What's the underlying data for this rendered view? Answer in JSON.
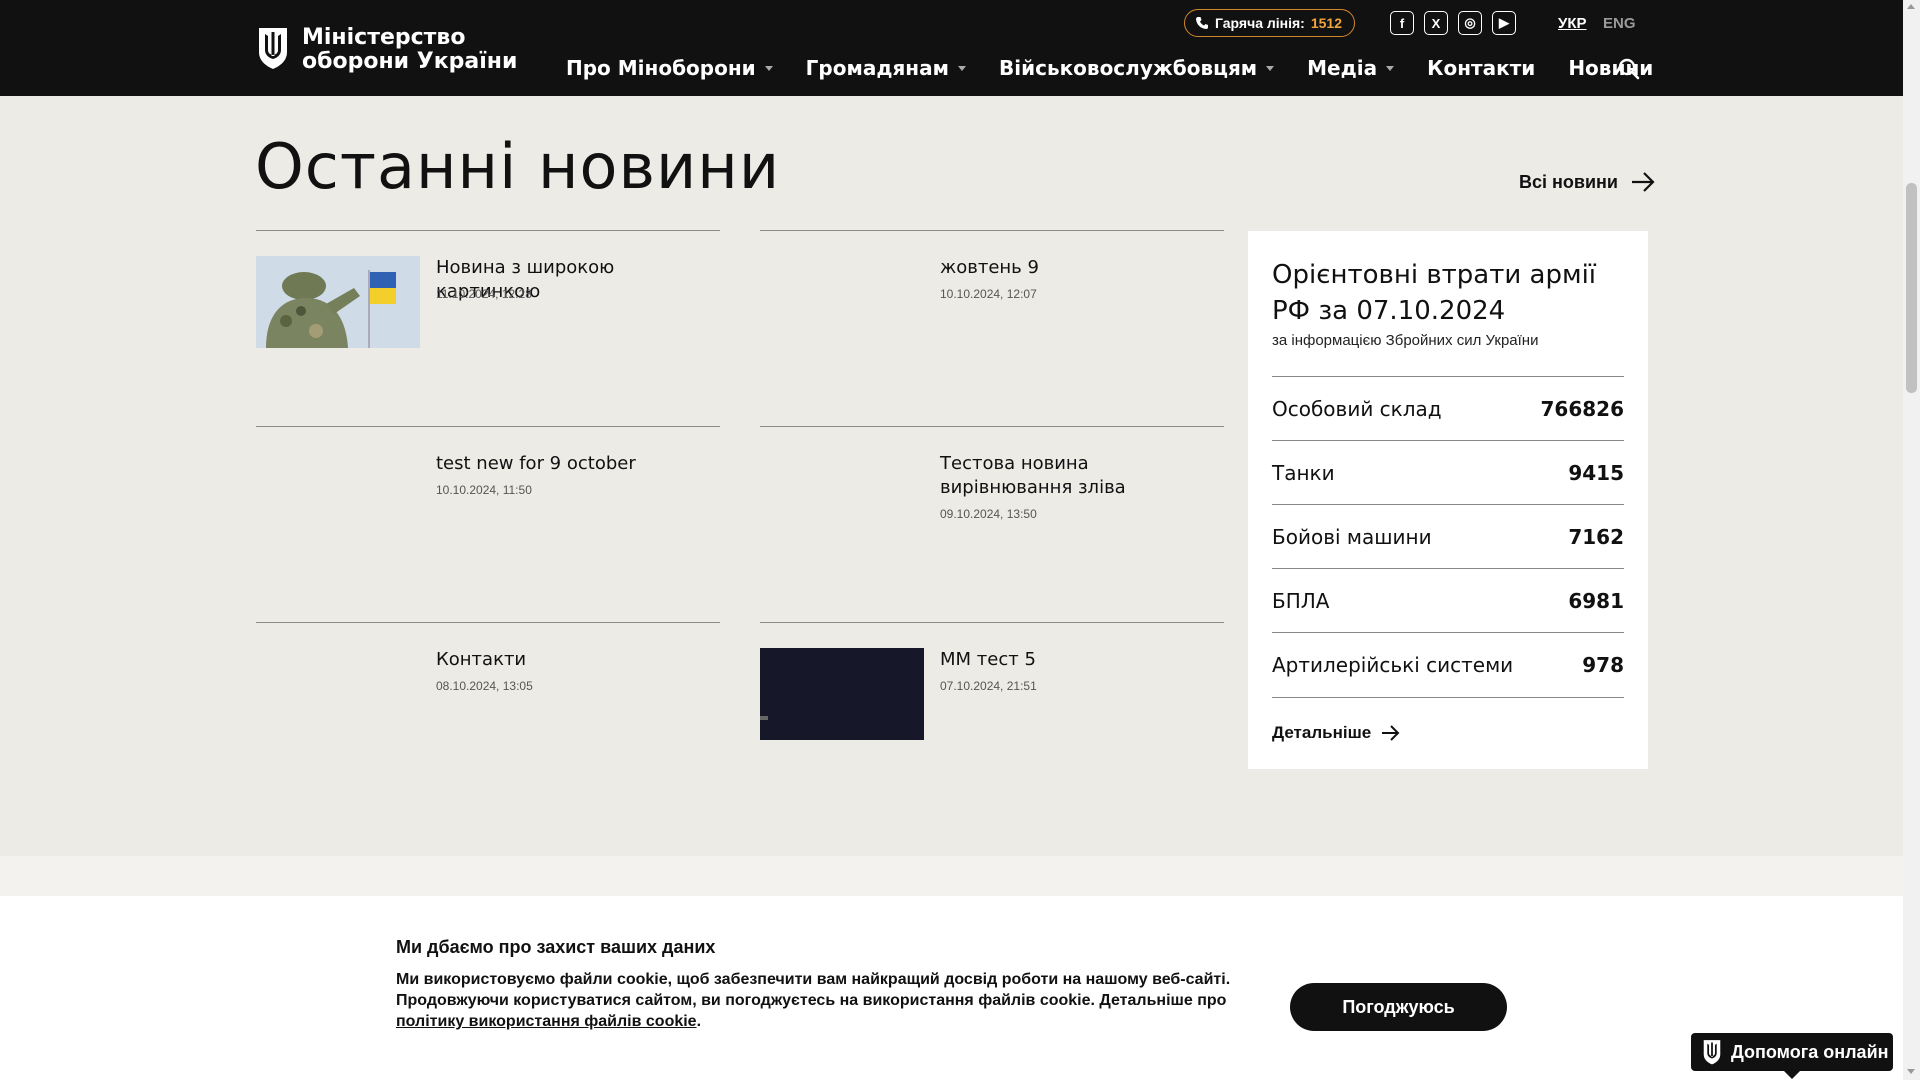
{
  "header": {
    "logo_line1": "Міністерство",
    "logo_line2": "оборони України",
    "hotline_label": "Гаряча лінія:",
    "hotline_number": "1512",
    "social": [
      {
        "icon": "facebook-icon",
        "glyph": "f"
      },
      {
        "icon": "x-icon",
        "glyph": "X"
      },
      {
        "icon": "instagram-icon",
        "glyph": "◎"
      },
      {
        "icon": "youtube-icon",
        "glyph": "▶"
      }
    ],
    "lang_ua": "УКР",
    "lang_en": "ENG",
    "nav": [
      {
        "label": "Про Міноборони",
        "dropdown": true
      },
      {
        "label": "Громадянам",
        "dropdown": true
      },
      {
        "label": "Військовослужбовцям",
        "dropdown": true
      },
      {
        "label": "Медіа",
        "dropdown": true
      },
      {
        "label": "Контакти",
        "dropdown": false
      },
      {
        "label": "Новини",
        "dropdown": false
      }
    ],
    "accent_color": "#f0a43c"
  },
  "news_section": {
    "title": "Останні новини",
    "all_link": "Всі новини",
    "items": [
      {
        "title": "Новина з широкою картинкою",
        "date": "11.10.2024, 12:28",
        "image": "soldier-saluting-flag"
      },
      {
        "title": "жовтень 9",
        "date": "10.10.2024, 12:07",
        "image": ""
      },
      {
        "title": "test new for 9 october",
        "date": "10.10.2024, 11:50",
        "image": ""
      },
      {
        "title": "Тестова новина вирівнювання зліва",
        "date": "09.10.2024, 13:50",
        "image": ""
      },
      {
        "title": "Контакти",
        "date": "08.10.2024, 13:05",
        "image": ""
      },
      {
        "title": "ММ тест 5",
        "date": "07.10.2024, 21:51",
        "image": "dark-thumbnail"
      }
    ]
  },
  "losses": {
    "title": "Орієнтовні втрати армії РФ за 07.10.2024",
    "subtitle": "за інформацією Збройних сил України",
    "rows": [
      {
        "label": "Особовий склад",
        "value": "766826"
      },
      {
        "label": "Танки",
        "value": "9415"
      },
      {
        "label": "Бойові машини",
        "value": "7162"
      },
      {
        "label": "БПЛА",
        "value": "6981"
      },
      {
        "label": "Артилерійські системи",
        "value": "978"
      }
    ],
    "more": "Детальніше"
  },
  "cookie": {
    "title": "Ми дбаємо про захист ваших даних",
    "text": "Ми використовуємо файли cookie, щоб забезпечити вам найкращий досвід роботи на нашому веб-сайті. Продовжуючи користуватися сайтом, ви погоджуєтесь на використання файлів cookie. Детальніше про ",
    "link": "політику використання файлів cookie",
    "suffix": ".",
    "accept": "Погоджуюсь"
  },
  "help": {
    "label": "Допомога онлайн"
  }
}
